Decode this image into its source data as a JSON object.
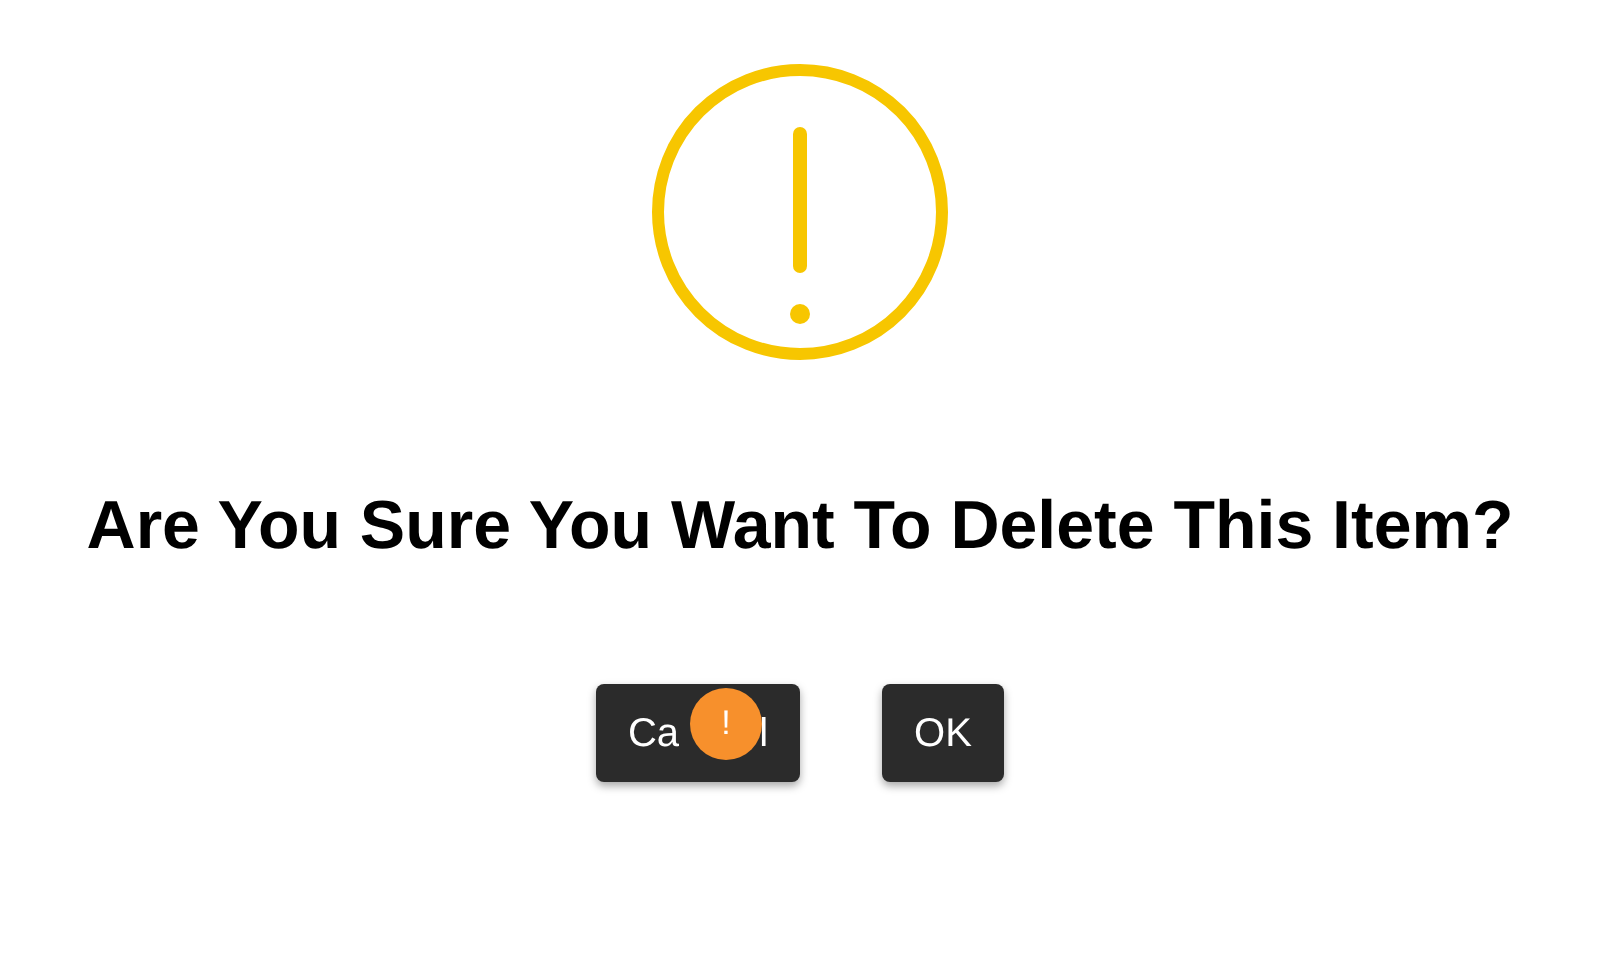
{
  "dialog": {
    "title": "Are You Sure You Want To Delete This Item?",
    "buttons": [
      {
        "label_parts": [
          "Ca",
          "l"
        ],
        "kind": "cancel"
      },
      {
        "label_parts": [
          "OK"
        ],
        "kind": "confirm"
      }
    ],
    "badge": {
      "text": "!"
    }
  }
}
